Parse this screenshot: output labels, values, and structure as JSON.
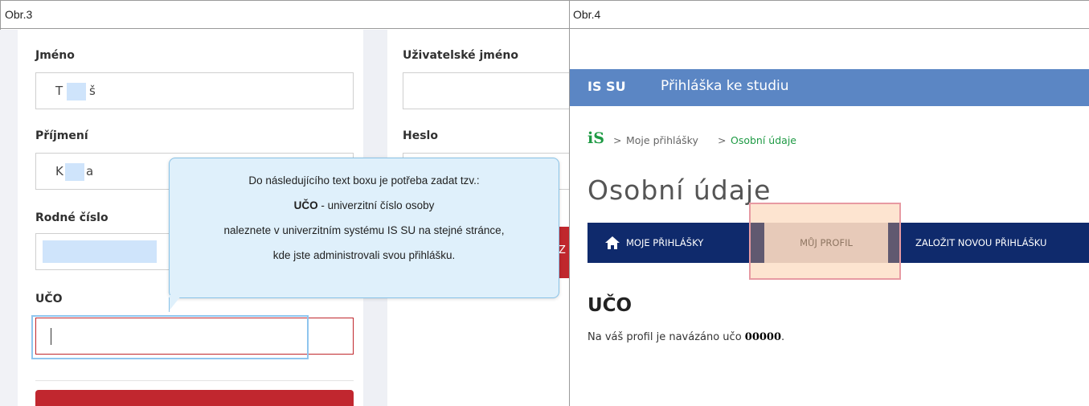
{
  "captions": {
    "left": "Obr.3",
    "right": "Obr.4"
  },
  "left_form": {
    "first_name_label": "Jméno",
    "first_name_initial": "T",
    "first_name_last": "š",
    "surname_label": "Příjmení",
    "surname_initial": "K",
    "surname_last": "a",
    "birth_number_label": "Rodné číslo",
    "uco_label": "UČO",
    "username_label": "Uživatelské jméno",
    "password_label": "Heslo",
    "side_button_letter": "Z"
  },
  "tooltip": {
    "line1": "Do následujícího text boxu je potřeba zadat tzv.:",
    "line2_bold": "UČO",
    "line2_rest": " - univerzitní číslo osoby",
    "line3": "naleznete v univerzitním systému IS SU na stejné stránce,",
    "line4": "kde jste administrovali svou přihlášku."
  },
  "right_app": {
    "brand": "IS SU",
    "app_title": "Přihláška ke studiu",
    "breadcrumb_logo": "iS",
    "breadcrumb_sep1": ">",
    "breadcrumb_item1": "Moje přihlášky",
    "breadcrumb_sep2": ">",
    "breadcrumb_item2": "Osobní údaje",
    "page_title": "Osobní údaje",
    "nav_tabs": [
      "MOJE PŘIHLÁŠKY",
      "MŮJ PROFIL",
      "ZALOŽIT NOVOU PŘIHLÁŠKU"
    ],
    "section_title": "UČO",
    "note_text": "Na váš profil je navázáno učo ",
    "note_value": "00000",
    "note_end": "."
  },
  "colors": {
    "brand_bar": "#5b86c4",
    "nav": "#0f2a6c",
    "accent_red": "#c1272f",
    "breadcrumb_active": "#1e9a44"
  }
}
